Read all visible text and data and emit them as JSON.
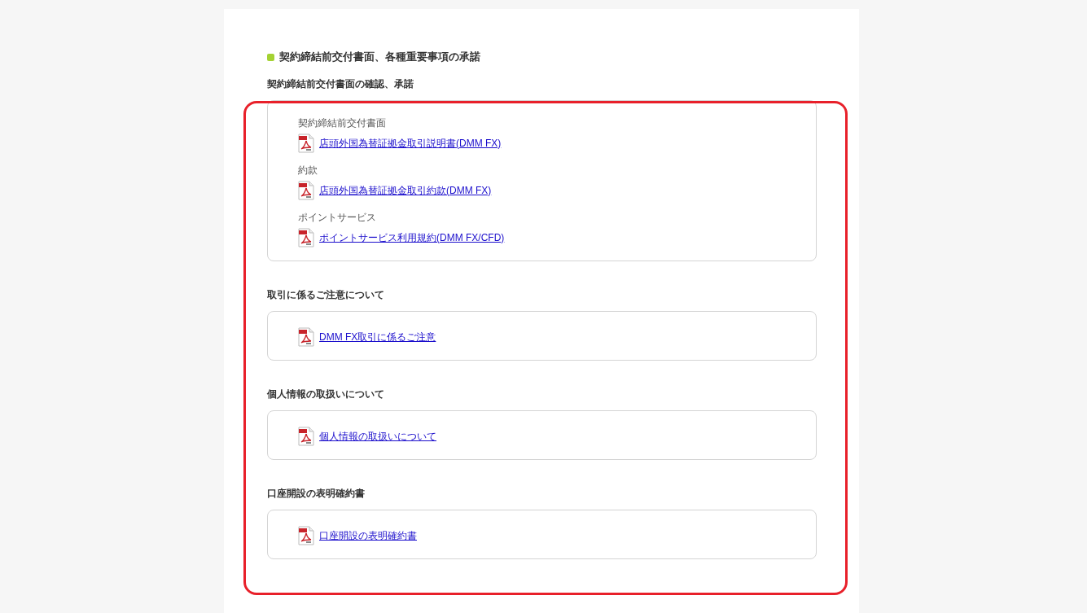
{
  "title": "契約締結前交付書面、各種重要事項の承諾",
  "sections": [
    {
      "heading": "契約締結前交付書面の確認、承諾",
      "items": [
        {
          "label": "契約締結前交付書面",
          "link": "店頭外国為替証拠金取引説明書(DMM FX)"
        },
        {
          "label": "約款",
          "link": "店頭外国為替証拠金取引約款(DMM FX)"
        },
        {
          "label": "ポイントサービス",
          "link": "ポイントサービス利用規約(DMM FX/CFD)"
        }
      ]
    },
    {
      "heading": "取引に係るご注意について",
      "items": [
        {
          "link": "DMM FX取引に係るご注意"
        }
      ]
    },
    {
      "heading": "個人情報の取扱いについて",
      "items": [
        {
          "link": "個人情報の取扱いについて"
        }
      ]
    },
    {
      "heading": "口座開設の表明確約書",
      "items": [
        {
          "link": "口座開設の表明確約書"
        }
      ]
    }
  ]
}
